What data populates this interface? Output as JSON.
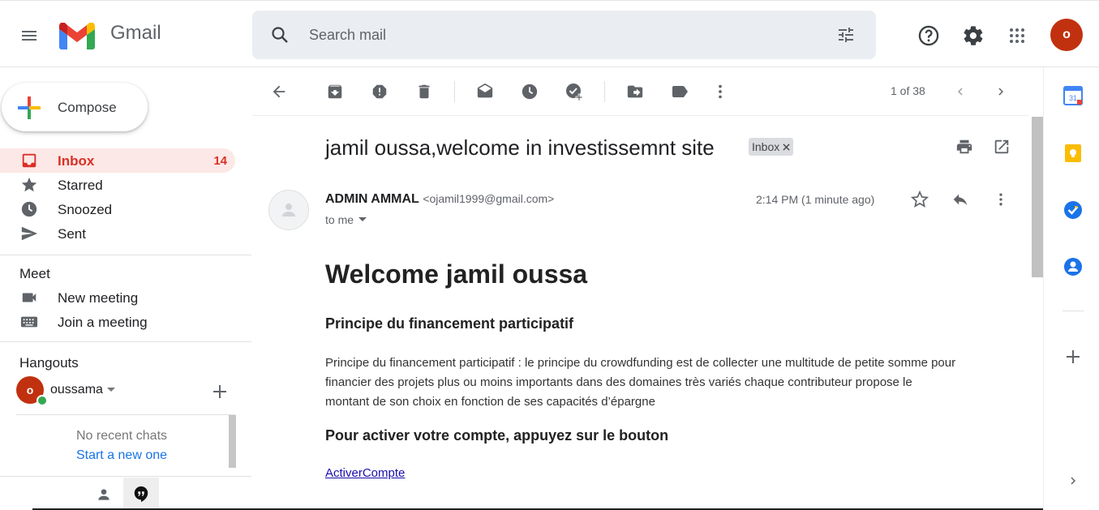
{
  "header": {
    "app_name": "Gmail",
    "search_placeholder": "Search mail",
    "user_initial": "o"
  },
  "sidebar": {
    "compose_label": "Compose",
    "items": [
      {
        "label": "Inbox",
        "count": "14"
      },
      {
        "label": "Starred"
      },
      {
        "label": "Snoozed"
      },
      {
        "label": "Sent"
      }
    ],
    "meet": {
      "title": "Meet",
      "new_meeting": "New meeting",
      "join_meeting": "Join a meeting"
    },
    "hangouts": {
      "title": "Hangouts",
      "user_name": "oussama",
      "user_initial": "o",
      "no_chats": "No recent chats",
      "start_new": "Start a new one"
    }
  },
  "toolbar": {
    "pagination": "1 of 38"
  },
  "email": {
    "subject": "jamil oussa,welcome in investissemnt site",
    "label_chip": "Inbox",
    "sender_name": "ADMIN AMMAL",
    "sender_email": "<ojamil1999@gmail.com>",
    "recipient": "to me",
    "time": "2:14 PM (1 minute ago)",
    "body": {
      "heading": "Welcome jamil oussa",
      "subheading": "Principe du financement participatif",
      "paragraph_lines": [
        "Principe du financement participatif : le principe du crowdfunding est de collecter une multitude de petite somme pour",
        "financier des projets plus ou moins importants dans des domaines très variés chaque contributeur propose le",
        "montant de son choix en fonction de ses capacités d’épargne"
      ],
      "cta_heading": "Pour activer votre compte, appuyez sur le bouton",
      "link_text": "ActiverCompte"
    }
  },
  "side_apps": {
    "calendar_day": "31"
  },
  "colors": {
    "accent_red": "#d93025",
    "avatar": "#c1310f",
    "link": "#1a0dab",
    "inbox_bg": "#fce8e6"
  }
}
